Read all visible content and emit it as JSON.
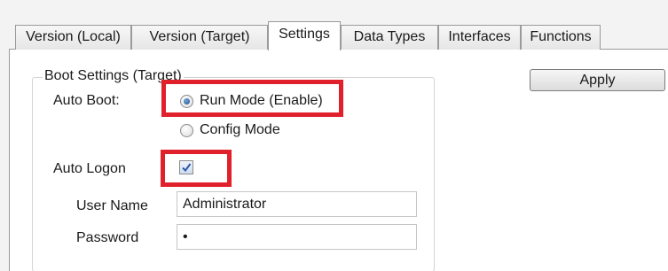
{
  "tabs": [
    {
      "label": "Version (Local)",
      "active": false
    },
    {
      "label": "Version (Target)",
      "active": false
    },
    {
      "label": "Settings",
      "active": true
    },
    {
      "label": "Data Types",
      "active": false
    },
    {
      "label": "Interfaces",
      "active": false
    },
    {
      "label": "Functions",
      "active": false
    }
  ],
  "apply_button": {
    "label": "Apply"
  },
  "boot_settings": {
    "legend": "Boot Settings (Target)",
    "auto_boot_label": "Auto Boot:",
    "run_mode_label": "Run Mode (Enable)",
    "run_mode_selected": true,
    "config_mode_label": "Config Mode",
    "config_mode_selected": false,
    "auto_logon_label": "Auto Logon",
    "auto_logon_checked": true,
    "user_name_label": "User Name",
    "user_name_value": "Administrator",
    "password_label": "Password",
    "password_value": "•"
  },
  "colors": {
    "highlight": "#e0202a",
    "radio_accent": "#1f4e8c",
    "page_background": "#ffffff",
    "window_background": "#f3f3f3"
  }
}
